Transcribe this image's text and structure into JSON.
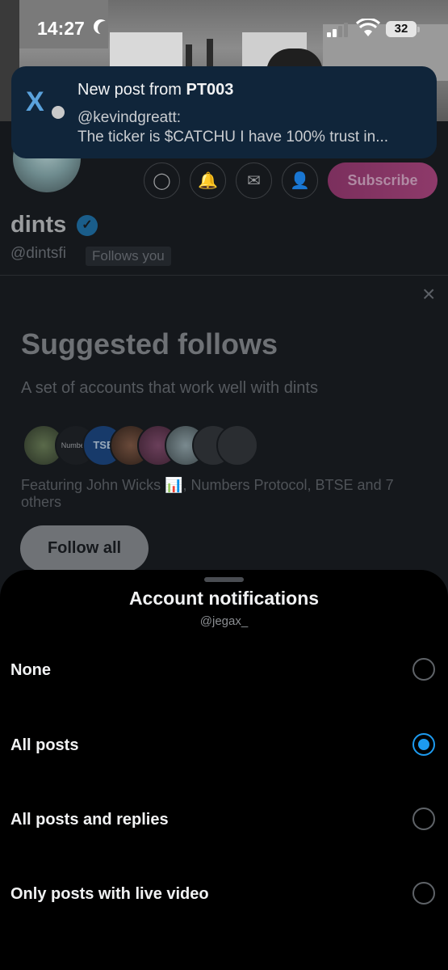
{
  "status_bar": {
    "time": "14:27",
    "battery": "32"
  },
  "notification": {
    "title_prefix": "New post from ",
    "title_author": "PT003",
    "line1": "@kevindgreatt:",
    "line2": "The ticker is $CATCHU  I have 100% trust in..."
  },
  "profile": {
    "display_name": "dints",
    "handle": "@dintsfi",
    "follows_you": "Follows you",
    "subscribe_label": "Subscribe"
  },
  "suggested": {
    "title": "Suggested follows",
    "subtitle": "A set of accounts that work well with dints",
    "featuring": "Featuring John Wicks 📊, Numbers Protocol, BTSE and 7 others",
    "follow_all_label": "Follow all",
    "avatar_labels": {
      "numbers": "Numbers",
      "btse": "TSE"
    }
  },
  "sheet": {
    "title": "Account notifications",
    "handle": "@jegax_",
    "options": [
      {
        "label": "None",
        "selected": false
      },
      {
        "label": "All posts",
        "selected": true
      },
      {
        "label": "All posts and replies",
        "selected": false
      },
      {
        "label": "Only posts with live video",
        "selected": false
      }
    ]
  },
  "colors": {
    "accent": "#1d9bf0",
    "subscribe": "#8e3a6a",
    "notification_bg": "#10253a"
  }
}
